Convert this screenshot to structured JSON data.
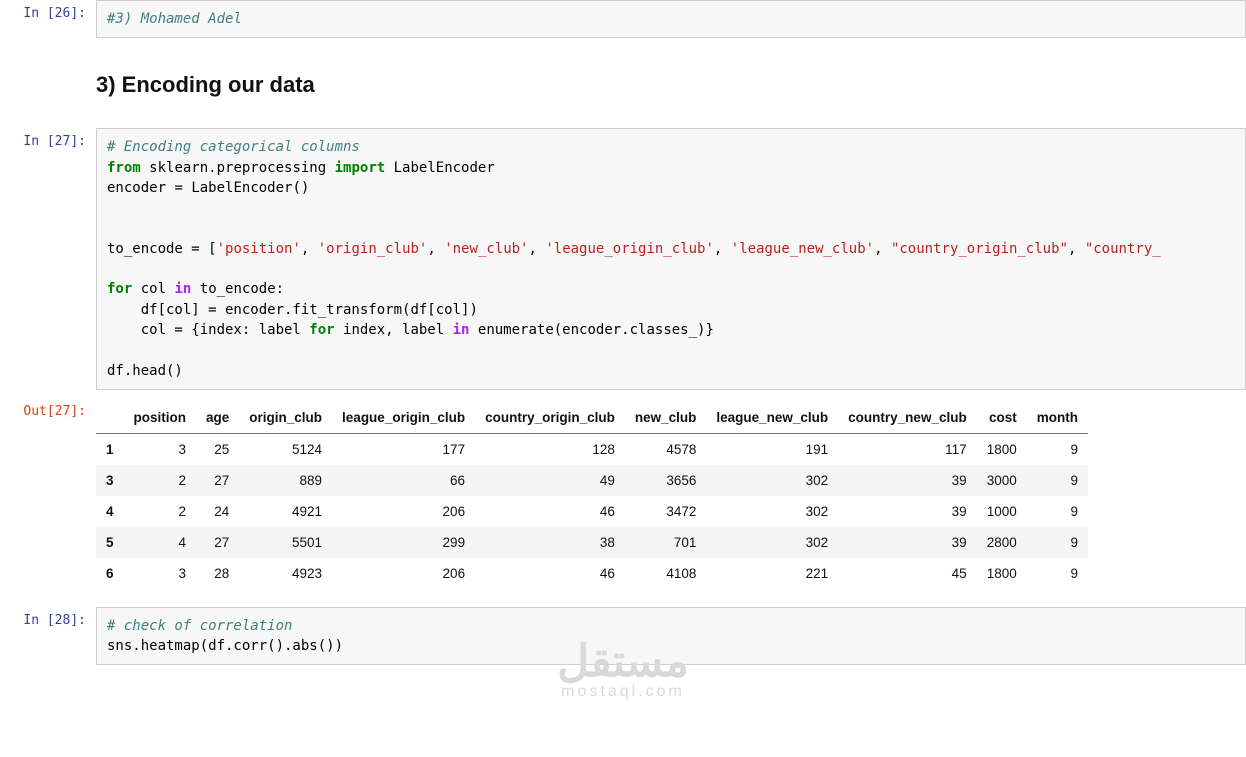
{
  "cells": {
    "c26": {
      "prompt": "In [26]:",
      "comment": "#3) Mohamed Adel"
    },
    "heading": "3) Encoding our data",
    "c27": {
      "prompt_in": "In [27]:",
      "prompt_out": "Out[27]:",
      "code": {
        "line1_comment": "# Encoding categorical columns",
        "kw_from": "from",
        "mod": "sklearn.preprocessing",
        "kw_import": "import",
        "cls": "LabelEncoder",
        "assign1_l": "encoder",
        "eq": "=",
        "assign1_r": "LabelEncoder()",
        "to_encode_l": "to_encode",
        "list_items": [
          "'position'",
          "'origin_club'",
          "'new_club'",
          "'league_origin_club'",
          "'league_new_club'",
          "\"country_origin_club\"",
          "\"country_"
        ],
        "kw_for": "for",
        "var_col": "col",
        "kw_in": "in",
        "iter": "to_encode:",
        "body1": "df[col] = encoder.fit_transform(df[col])",
        "body2_a": "col = {index: label ",
        "body2_for": "for",
        "body2_b": " index, label ",
        "body2_in": "in",
        "body2_c": " enumerate(encoder.classes_)}",
        "tail": "df.head()"
      }
    },
    "c28": {
      "prompt": "In [28]:",
      "comment": "# check of correlation",
      "code": "sns.heatmap(df.corr().abs())"
    }
  },
  "chart_data": {
    "type": "table",
    "columns": [
      "position",
      "age",
      "origin_club",
      "league_origin_club",
      "country_origin_club",
      "new_club",
      "league_new_club",
      "country_new_club",
      "cost",
      "month"
    ],
    "index": [
      "1",
      "3",
      "4",
      "5",
      "6"
    ],
    "rows": [
      [
        3,
        25.0,
        5124,
        177,
        128,
        4578,
        191,
        117,
        1800.0,
        9
      ],
      [
        2,
        27.0,
        889,
        66,
        49,
        3656,
        302,
        39,
        3000.0,
        9
      ],
      [
        2,
        24.0,
        4921,
        206,
        46,
        3472,
        302,
        39,
        1000.0,
        9
      ],
      [
        4,
        27.0,
        5501,
        299,
        38,
        701,
        302,
        39,
        2800.0,
        9
      ],
      [
        3,
        28.0,
        4923,
        206,
        46,
        4108,
        221,
        45,
        1800.0,
        9
      ]
    ]
  },
  "watermark": {
    "ar": "مستقل",
    "en": "mostaql.com"
  }
}
